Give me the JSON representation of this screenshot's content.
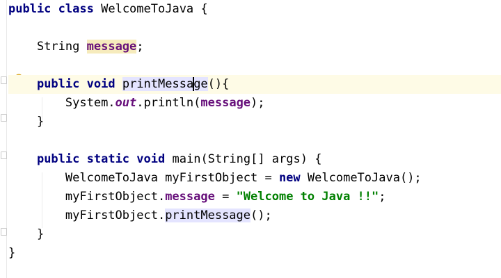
{
  "code": {
    "line1": {
      "kw1": "public",
      "kw2": "class",
      "name": "WelcomeToJava",
      "brace": "{"
    },
    "line2": {
      "type": "String",
      "field": "message",
      "semi": ";"
    },
    "line3": {
      "kw1": "public",
      "kw2": "void",
      "method_a": "printMessa",
      "method_b": "ge",
      "rest": "(){"
    },
    "line4": {
      "obj": "System.",
      "out": "out",
      "call": ".println(",
      "arg": "message",
      "end": ");"
    },
    "line5": {
      "brace": "}"
    },
    "line6": {
      "kw1": "public",
      "kw2": "static",
      "kw3": "void",
      "rest": "main(String[] args) {"
    },
    "line7": {
      "decl": "WelcomeToJava myFirstObject = ",
      "kw": "new",
      "rest": "WelcomeToJava();"
    },
    "line8": {
      "obj": "myFirstObject.",
      "field": "message",
      "mid": " = ",
      "str": "\"Welcome to Java !!\"",
      "end": ";"
    },
    "line9": {
      "obj": "myFirstObject.",
      "method": "printMessage",
      "end": "();"
    },
    "line10": {
      "brace": "}"
    },
    "line11": {
      "brace": "}"
    }
  },
  "icons": {
    "intention": "lightbulb-icon"
  },
  "colors": {
    "keyword": "#000080",
    "field": "#660e7a",
    "string": "#008000",
    "current_line": "#fefbe6",
    "usage_highlight": "#f6ebbc",
    "method_highlight": "#e4e4ff"
  }
}
